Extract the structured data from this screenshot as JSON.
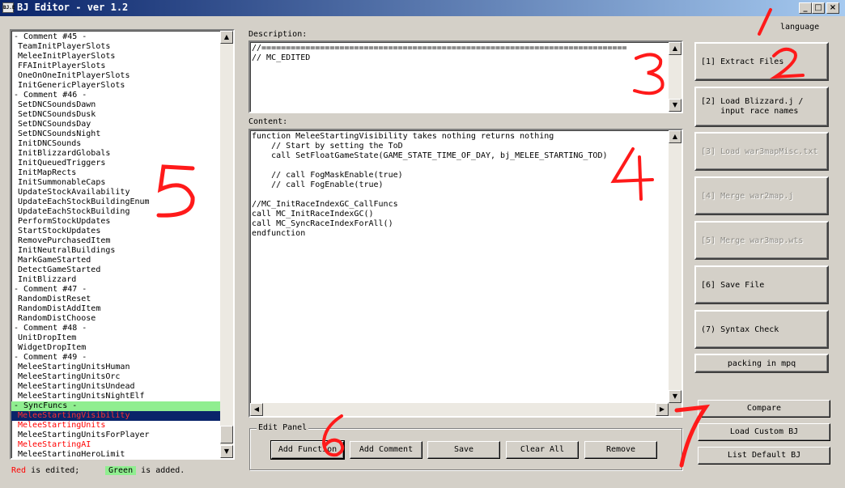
{
  "window": {
    "title": "BJ Editor - ver 1.2",
    "icon_text": "BJ.E",
    "minimize": "_",
    "maximize": "□",
    "close": "×"
  },
  "language_label": "language",
  "function_list": [
    {
      "text": "- Comment #45 -",
      "kind": "comment"
    },
    {
      "text": "TeamInitPlayerSlots"
    },
    {
      "text": "MeleeInitPlayerSlots"
    },
    {
      "text": "FFAInitPlayerSlots"
    },
    {
      "text": "OneOnOneInitPlayerSlots"
    },
    {
      "text": "InitGenericPlayerSlots"
    },
    {
      "text": "- Comment #46 -",
      "kind": "comment"
    },
    {
      "text": "SetDNCSoundsDawn"
    },
    {
      "text": "SetDNCSoundsDusk"
    },
    {
      "text": "SetDNCSoundsDay"
    },
    {
      "text": "SetDNCSoundsNight"
    },
    {
      "text": "InitDNCSounds"
    },
    {
      "text": "InitBlizzardGlobals"
    },
    {
      "text": "InitQueuedTriggers"
    },
    {
      "text": "InitMapRects"
    },
    {
      "text": "InitSummonableCaps"
    },
    {
      "text": "UpdateStockAvailability"
    },
    {
      "text": "UpdateEachStockBuildingEnum"
    },
    {
      "text": "UpdateEachStockBuilding"
    },
    {
      "text": "PerformStockUpdates"
    },
    {
      "text": "StartStockUpdates"
    },
    {
      "text": "RemovePurchasedItem"
    },
    {
      "text": "InitNeutralBuildings"
    },
    {
      "text": "MarkGameStarted"
    },
    {
      "text": "DetectGameStarted"
    },
    {
      "text": "InitBlizzard"
    },
    {
      "text": "- Comment #47 -",
      "kind": "comment"
    },
    {
      "text": "RandomDistReset"
    },
    {
      "text": "RandomDistAddItem"
    },
    {
      "text": "RandomDistChoose"
    },
    {
      "text": "- Comment #48 -",
      "kind": "comment"
    },
    {
      "text": "UnitDropItem"
    },
    {
      "text": "WidgetDropItem"
    },
    {
      "text": "- Comment #49 -",
      "kind": "comment"
    },
    {
      "text": "MeleeStartingUnitsHuman"
    },
    {
      "text": "MeleeStartingUnitsOrc"
    },
    {
      "text": "MeleeStartingUnitsUndead"
    },
    {
      "text": "MeleeStartingUnitsNightElf"
    },
    {
      "text": "- SyncFuncs -",
      "kind": "added"
    },
    {
      "text": "MeleeStartingVisibility",
      "kind": "selected-edited"
    },
    {
      "text": "MeleeStartingUnits",
      "kind": "edited"
    },
    {
      "text": "MeleeStartingUnitsForPlayer"
    },
    {
      "text": "MeleeStartingAI",
      "kind": "edited"
    },
    {
      "text": "MeleeStartingHeroLimit"
    }
  ],
  "legend": {
    "red": "Red",
    "red_text": "is edited;",
    "green": "Green",
    "green_text": "is added.",
    "red_color": "#ff0000",
    "green_color": "#90ee90"
  },
  "description": {
    "label": "Description:",
    "text": "//===========================================================================\n// MC_EDITED"
  },
  "content": {
    "label": "Content:",
    "text": "function MeleeStartingVisibility takes nothing returns nothing\n    // Start by setting the ToD\n    call SetFloatGameState(GAME_STATE_TIME_OF_DAY, bj_MELEE_STARTING_TOD)\n\n    // call FogMaskEnable(true)\n    // call FogEnable(true)\n\n//MC_InitRaceIndexGC_CallFuncs\ncall MC_InitRaceIndexGC()\ncall MC_SyncRaceIndexForAll()\nendfunction"
  },
  "steps": {
    "extract": "[1] Extract Files",
    "load_blizzard": "[2] Load Blizzard.j /\n    input race names",
    "load_misc": "[3] Load war3mapMisc.txt",
    "merge_j": "[4] Merge war2map.j",
    "merge_wts": "[5] Merge war3map.wts",
    "save": "[6] Save File",
    "syntax": "(7) Syntax Check",
    "packing": "packing in mpq"
  },
  "edit_panel": {
    "label": "Edit Panel",
    "add_function": "Add Function",
    "add_comment": "Add Comment",
    "save": "Save",
    "clear_all": "Clear All",
    "remove": "Remove"
  },
  "bottom_right": {
    "compare": "Compare",
    "load_custom": "Load Custom BJ",
    "list_default": "List Default BJ"
  },
  "annotations": [
    "1",
    "2",
    "3",
    "4",
    "5",
    "6",
    "7"
  ],
  "scroll_arrows": {
    "up": "▲",
    "down": "▼",
    "left": "◀",
    "right": "▶"
  }
}
